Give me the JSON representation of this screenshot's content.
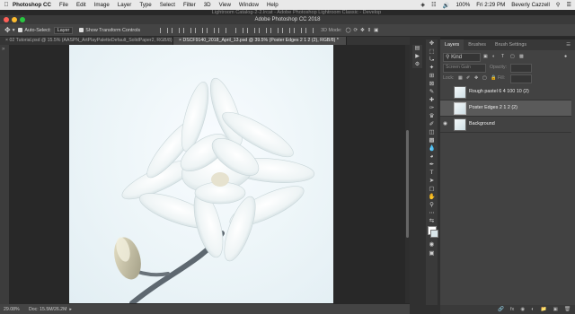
{
  "menubar": {
    "app": "Photoshop CC",
    "items": [
      "File",
      "Edit",
      "Image",
      "Layer",
      "Type",
      "Select",
      "Filter",
      "3D",
      "View",
      "Window",
      "Help"
    ],
    "battery": "100%",
    "clock": "Fri 2:29 PM",
    "user": "Beverly Cazzell"
  },
  "window": {
    "background_title": "Lightroom Catalog-2-2.lrcat - Adobe Photoshop Lightroom Classic - Develop",
    "title": "Adobe Photoshop CC 2018"
  },
  "options": {
    "auto_select_label": "Auto-Select:",
    "auto_select_value": "Layer",
    "transform_label": "Show Transform Controls",
    "mode_label": "3D Mode:"
  },
  "tabs": [
    {
      "label": "02 Tutorial.psd @ 15.5% (AASPN_ArtPlayPaletteDefault_SolidPaper2, RGB/8)"
    },
    {
      "label": "DSCF9140_2018_April_13.psd @ 39.5% (Poster Edges 2 1 2 (2), RGB/8) *"
    }
  ],
  "status": {
    "zoom": "29.08%",
    "doc": "Doc: 15.5M/26.2M"
  },
  "panel": {
    "tabs": [
      "Layers",
      "Brushes",
      "Brush Settings"
    ],
    "kind_label": "Kind",
    "blend_mode": "Screen Gain",
    "opacity_label": "Opacity:",
    "lock_label": "Lock:",
    "fill_label": "Fill:",
    "layers": [
      {
        "name": "Rough pastel 6 4 100 10 (2)",
        "visible": false,
        "selected": false
      },
      {
        "name": "Poster Edges 2 1 2 (2)",
        "visible": false,
        "selected": true
      },
      {
        "name": "Background",
        "visible": true,
        "selected": false
      }
    ]
  },
  "colors": {
    "menubar": "#e9e9e9",
    "workspace": "#282828",
    "panel": "#424242",
    "selected_layer": "#5a5a5a"
  }
}
